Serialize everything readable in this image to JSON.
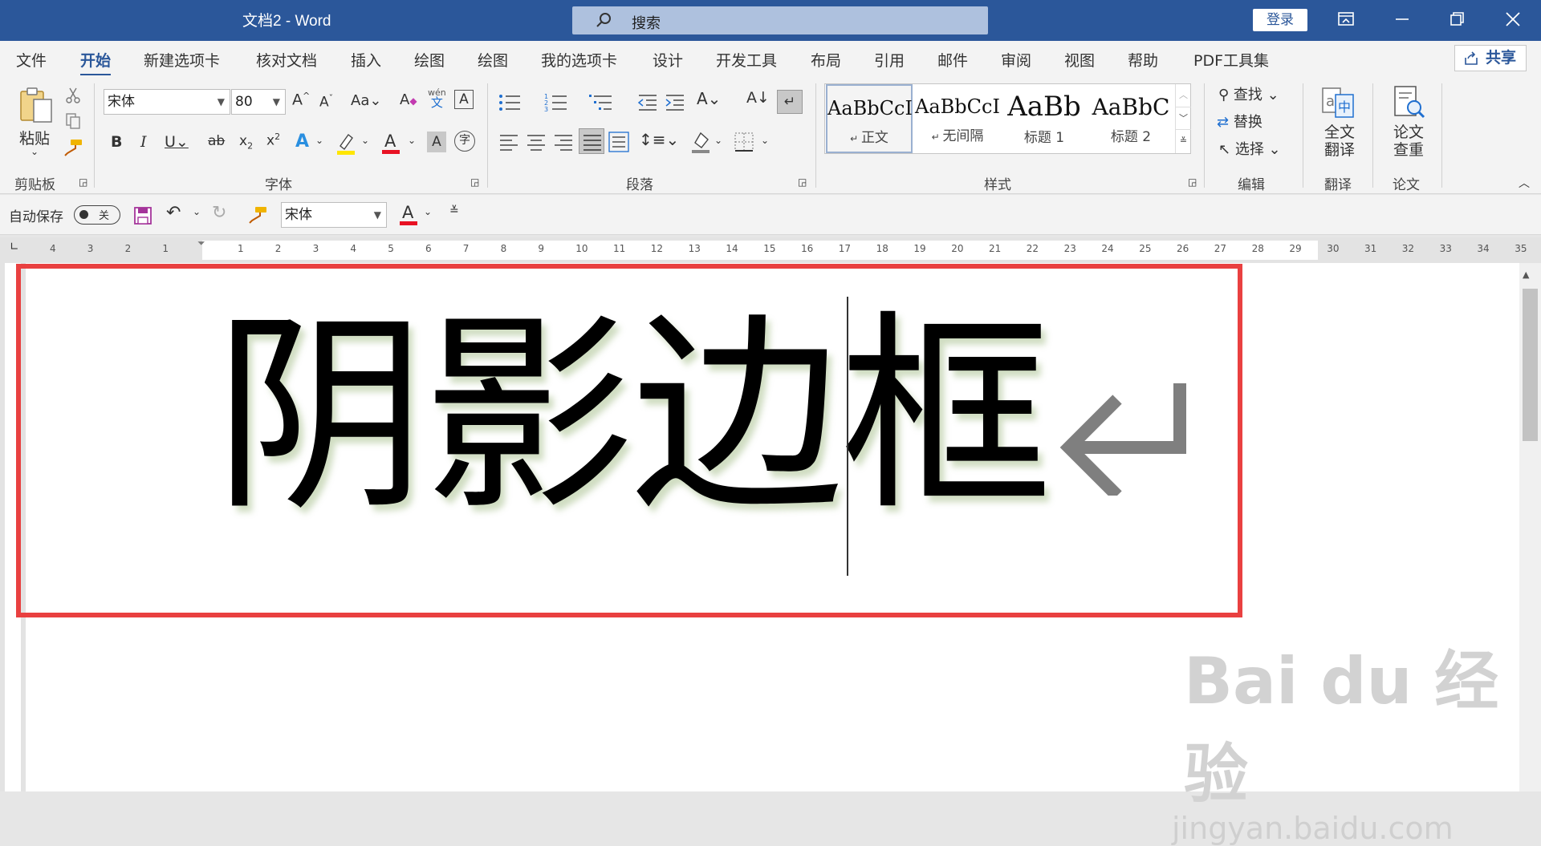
{
  "window": {
    "title": "文档2  -  Word",
    "search_placeholder": "搜索",
    "login": "登录"
  },
  "menu": {
    "tabs": [
      "文件",
      "开始",
      "新建选项卡",
      "核对文档",
      "插入",
      "绘图",
      "绘图",
      "我的选项卡",
      "设计",
      "开发工具",
      "布局",
      "引用",
      "邮件",
      "审阅",
      "视图",
      "帮助",
      "PDF工具集"
    ],
    "active_tab": "开始",
    "share": "共享"
  },
  "ribbon": {
    "clipboard": {
      "paste": "粘贴",
      "label": "剪贴板"
    },
    "font": {
      "name": "宋体",
      "size": "80",
      "label": "字体",
      "phonetic_top": "wén",
      "phonetic_bottom": "文",
      "enclose": "字"
    },
    "paragraph": {
      "label": "段落"
    },
    "styles": {
      "label": "样式",
      "items": [
        {
          "sample": "AaBbCcI",
          "name": "正文"
        },
        {
          "sample": "AaBbCcI",
          "name": "无间隔"
        },
        {
          "sample": "AaBb",
          "name": "标题 1"
        },
        {
          "sample": "AaBbC",
          "name": "标题 2"
        }
      ]
    },
    "editing": {
      "find": "查找",
      "replace": "替换",
      "select": "选择",
      "label": "编辑"
    },
    "translate": {
      "button_line1": "全文",
      "button_line2": "翻译",
      "label": "翻译"
    },
    "paper": {
      "button_line1": "论文",
      "button_line2": "查重",
      "label": "论文"
    }
  },
  "quick_access": {
    "autosave": "自动保存",
    "autosave_state": "关",
    "font_name": "宋体"
  },
  "ruler": {
    "numbers": [
      "4",
      "3",
      "2",
      "1",
      "",
      "1",
      "2",
      "3",
      "4",
      "5",
      "6",
      "7",
      "8",
      "9",
      "10",
      "11",
      "12",
      "13",
      "14",
      "15",
      "16",
      "17",
      "18",
      "19",
      "20",
      "21",
      "22",
      "23",
      "24",
      "25",
      "26",
      "27",
      "28",
      "29",
      "30",
      "31",
      "32",
      "33",
      "34",
      "35"
    ]
  },
  "document": {
    "text": "阴影边框"
  },
  "watermark": {
    "line1": "Bai du 经验",
    "line2": "jingyan.baidu.com"
  },
  "colors": {
    "title_bar": "#2b579a",
    "highlight": "#e94040",
    "font_color_bar": "#e81123",
    "highlight_color_bar": "#ffe600"
  }
}
